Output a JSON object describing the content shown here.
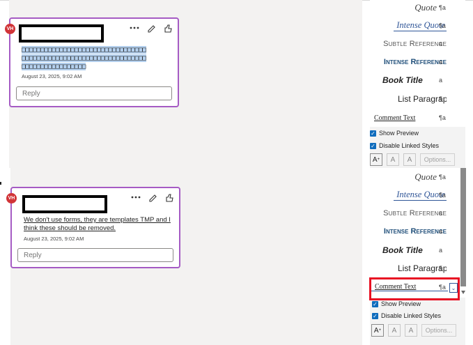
{
  "top_panel": {
    "comment": {
      "avatar_initials": "VH",
      "body_selected": "□□□□□□□□□□□□□□□□□□□□□□□□□□□□□□□□□\n□□□□□□□□□□□□□□□□□□□□□□□□□□□□□□□□□\n□□□□□□□□□□□□□□□□□",
      "line1": "□□□□□□□□□□□□□□□□□□□□□□□□□□□□□□□□□",
      "line2": "□□□□□□□□□□□□□□□□□□□□□□□□□□□□□□□□□",
      "line3": "□□□□□□□□□□□□□□□□□",
      "date": "August 23, 2025, 9:02 AM",
      "reply_placeholder": "Reply"
    },
    "styles": {
      "items": [
        "Quote",
        "Intense Quote",
        "Subtle Reference",
        "Intense Reference",
        "Book Title",
        "List Paragraph",
        "Comment Text"
      ],
      "marks": [
        "¶a",
        "¶a",
        "a",
        "a",
        "a",
        "¶",
        "¶a"
      ],
      "show_preview": "Show Preview",
      "disable_linked": "Disable Linked Styles",
      "options": "Options..."
    }
  },
  "bottom_panel": {
    "comment": {
      "avatar_initials": "VH",
      "line1": "We don't use forms, they are templates TMP and I",
      "line2": "think these should be removed.",
      "date": "August 23, 2025, 9:02 AM",
      "reply_placeholder": "Reply"
    },
    "styles": {
      "items": [
        "Quote",
        "Intense Quote",
        "Subtle Reference",
        "Intense Reference",
        "Book Title",
        "List Paragraph",
        "Comment Text"
      ],
      "marks": [
        "¶a",
        "¶a",
        "a",
        "a",
        "a",
        "¶",
        "¶a"
      ],
      "show_preview": "Show Preview",
      "disable_linked": "Disable Linked Styles",
      "options": "Options..."
    }
  },
  "colors": {
    "card_border": "#a55bc4",
    "avatar": "#d13438",
    "highlight": "#e81123",
    "selection": "#b4d0ee"
  }
}
